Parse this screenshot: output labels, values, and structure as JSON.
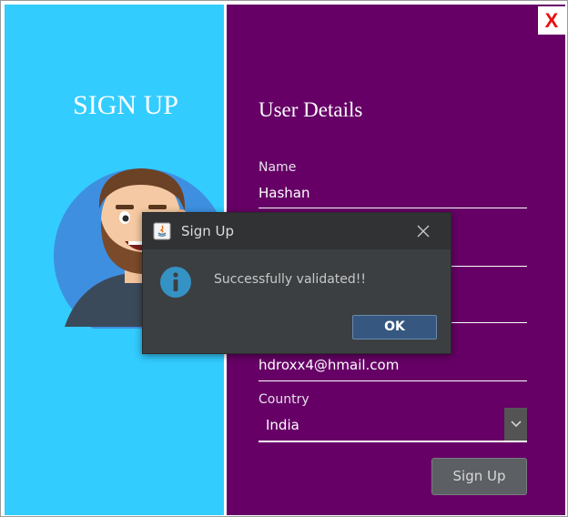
{
  "window": {
    "close_label": "X",
    "close_color": "#e81010"
  },
  "left_panel": {
    "heading": "SIGN UP",
    "background": "#33ccff",
    "avatar_icon": "bearded-man-avatar-icon"
  },
  "right_panel": {
    "background": "#660066",
    "section_title": "User Details",
    "fields": [
      {
        "label": "Name",
        "value": "Hashan"
      },
      {
        "label": "",
        "value": ""
      },
      {
        "label": "",
        "value": ""
      },
      {
        "label": "",
        "value": "hdroxx4@hmail.com"
      }
    ],
    "country": {
      "label": "Country",
      "value": "India",
      "arrow_icon": "chevron-down-icon"
    },
    "signup_button": "Sign Up"
  },
  "dialog": {
    "title": "Sign Up",
    "title_icon": "java-icon",
    "close_icon": "close-icon",
    "info_icon": "info-icon",
    "message": "Successfully validated!!",
    "ok_button": "OK"
  }
}
